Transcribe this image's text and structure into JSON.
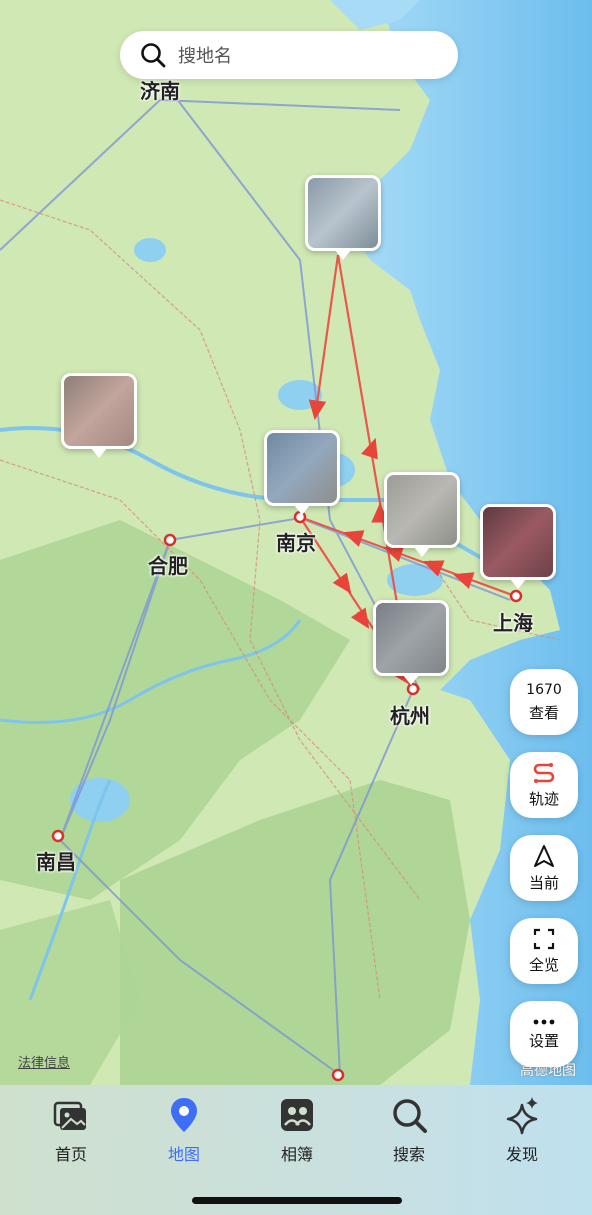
{
  "search": {
    "placeholder": "搜地名"
  },
  "cities": [
    {
      "name": "济南"
    },
    {
      "name": "合肥"
    },
    {
      "name": "南京"
    },
    {
      "name": "上海"
    },
    {
      "name": "杭州"
    },
    {
      "name": "南昌"
    }
  ],
  "controls": {
    "view_count": "1670",
    "view_label": "查看",
    "track_label": "轨迹",
    "current_label": "当前",
    "overview_label": "全览",
    "settings_label": "设置"
  },
  "map_footer": {
    "legal": "法律信息",
    "provider": "高德地图"
  },
  "tabs": [
    {
      "label": "首页",
      "icon": "photos-icon"
    },
    {
      "label": "地图",
      "icon": "map-pin-icon",
      "active": true
    },
    {
      "label": "相簿",
      "icon": "album-icon"
    },
    {
      "label": "搜索",
      "icon": "search-icon"
    },
    {
      "label": "发现",
      "icon": "sparkle-icon"
    }
  ],
  "colors": {
    "route": "#e8584c",
    "accent": "#3d6ef5",
    "sea": "#7cc3ee",
    "land": "#cfe7b9"
  }
}
